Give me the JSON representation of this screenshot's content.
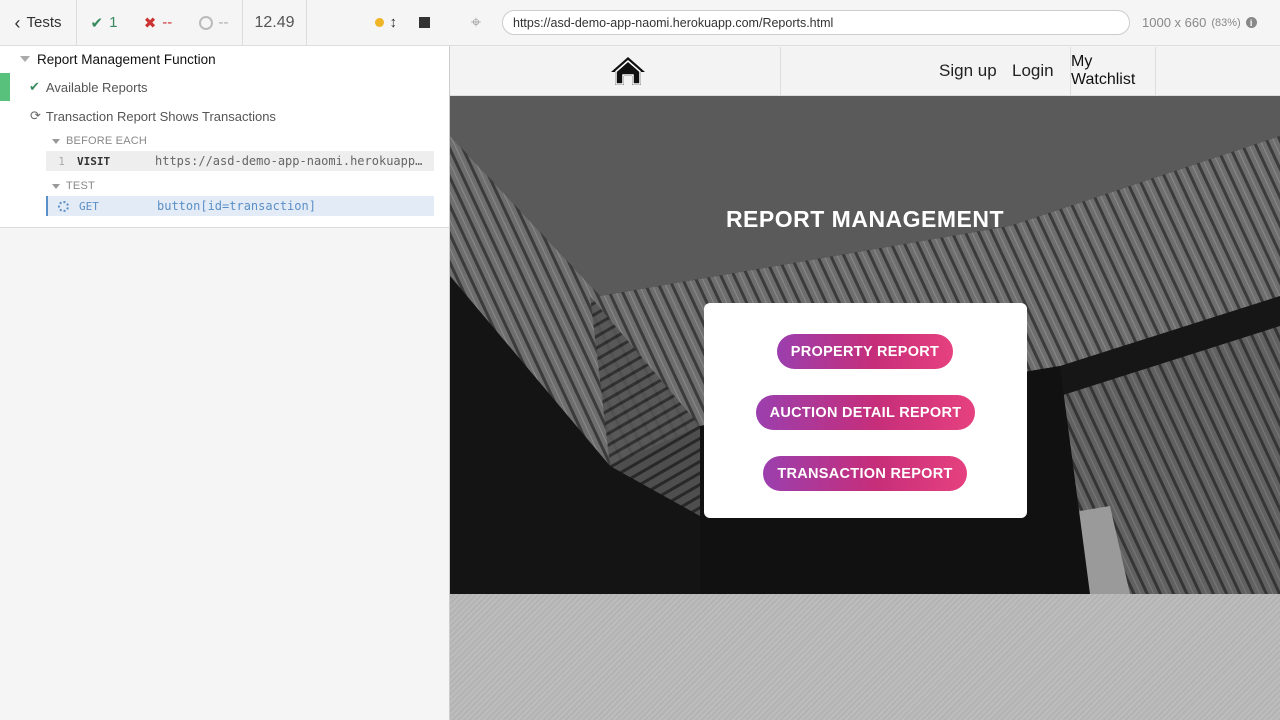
{
  "reporter": {
    "tests_label": "Tests",
    "passed_count": "1",
    "failed_count": "--",
    "pending_count": "--",
    "duration": "12.49",
    "suite_title": "Report Management Function",
    "tests": [
      {
        "title": "Available Reports",
        "state": "passed"
      },
      {
        "title": "Transaction Report Shows Transactions",
        "state": "running"
      }
    ],
    "sections": {
      "before_each": "BEFORE EACH",
      "test": "TEST"
    },
    "commands": [
      {
        "number": "1",
        "name": "VISIT",
        "message": "https://asd-demo-app-naomi.herokuapp.com/Reports.html"
      },
      {
        "number": "",
        "name": "GET",
        "message": "button[id=transaction]"
      }
    ]
  },
  "aut": {
    "url": "https://asd-demo-app-naomi.herokuapp.com/Reports.html",
    "viewport": "1000 x 660",
    "zoom": "(83%)",
    "icons": [
      "selector-playground-icon",
      "info-icon"
    ]
  },
  "app": {
    "nav": {
      "home_icon": "home-icon",
      "signup": "Sign up",
      "login": "Login",
      "watchlist": "My Watchlist"
    },
    "hero_title": "REPORT MANAGEMENT",
    "buttons": {
      "property": "PROPERTY REPORT",
      "auction": "AUCTION DETAIL REPORT",
      "transaction": "TRANSACTION REPORT"
    }
  },
  "colors": {
    "pass_green": "#58c27d",
    "fail_red": "#cc3333",
    "running_blue": "#5b8fc7",
    "button_gradient_start": "#9b3fae",
    "button_gradient_end": "#e6417f"
  }
}
